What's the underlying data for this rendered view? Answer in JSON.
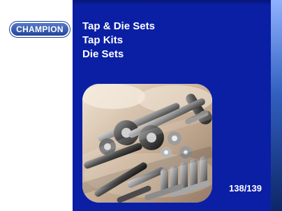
{
  "brand": {
    "logo_text": "CHAMPION"
  },
  "heading": {
    "line_1": "Tap & Die Sets",
    "line_2": "Tap Kits",
    "line_3": "Die Sets"
  },
  "page": {
    "number_range": "138/139"
  },
  "colors": {
    "primary_blue": "#0b1fa5",
    "logo_blue": "#1e3f96",
    "white": "#ffffff"
  },
  "image": {
    "subject": "tap and die set"
  }
}
